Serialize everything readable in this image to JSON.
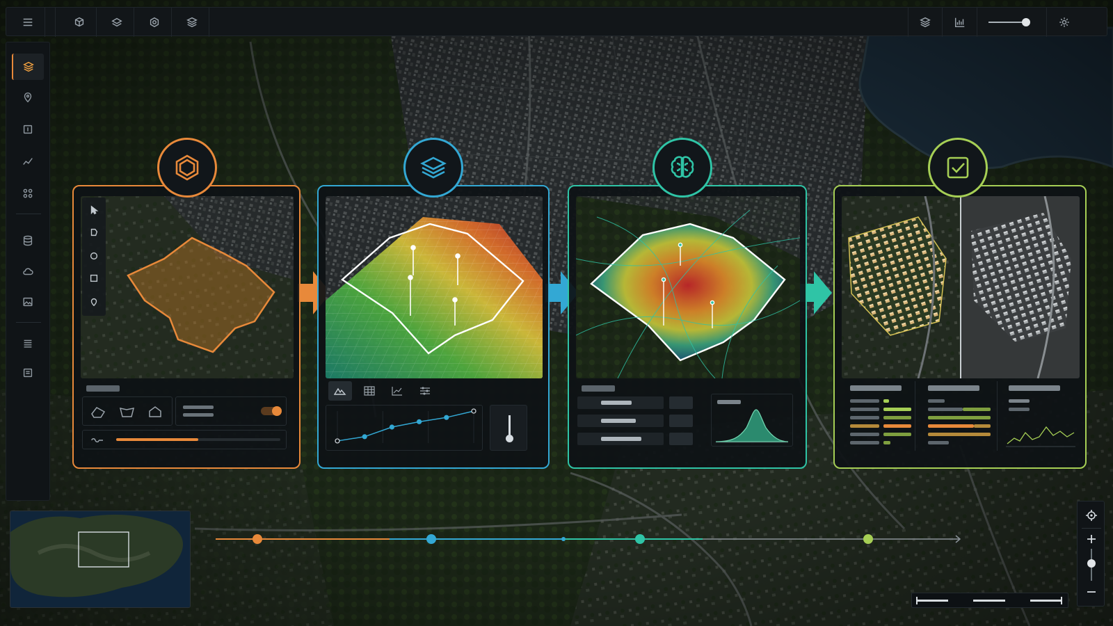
{
  "app": {
    "title": ""
  },
  "colors": {
    "stage1": "#e8893a",
    "stage2": "#33a8d4",
    "stage3": "#2fc4a6",
    "stage4": "#a6cf55",
    "panel_bg": "#0e1215",
    "toolbar_bg": "#121619"
  },
  "topbar": {
    "left_icons": [
      "menu-icon",
      "cube-icon",
      "layers-icon",
      "hexagon-icon",
      "stack-icon"
    ],
    "right_icons": [
      "layers-icon",
      "analytics-chart-icon",
      "opacity-slider",
      "gear-icon"
    ],
    "opacity_slider_value": 0.85
  },
  "sidebar": {
    "items": [
      {
        "icon": "layers-icon",
        "active": true
      },
      {
        "icon": "map-pin-icon",
        "active": false
      },
      {
        "icon": "frame-icon",
        "active": false
      },
      {
        "icon": "trend-line-icon",
        "active": false
      },
      {
        "icon": "network-icon",
        "active": false
      },
      {
        "icon": "database-icon",
        "active": false
      },
      {
        "icon": "cloud-icon",
        "active": false
      },
      {
        "icon": "image-icon",
        "active": false
      },
      {
        "icon": "list-icon",
        "active": false
      },
      {
        "icon": "report-icon",
        "active": false
      }
    ]
  },
  "stages": [
    {
      "id": "define-area",
      "icon": "hexagon-icon",
      "tools": [
        "pointer-icon",
        "polygon-icon",
        "circle-icon",
        "square-icon",
        "map-pin-icon"
      ],
      "progress": 0.5,
      "toggle_on": true
    },
    {
      "id": "layer-analysis",
      "icon": "layers-icon",
      "tabs": [
        "terrain-icon",
        "grid-icon",
        "line-chart-icon",
        "sliders-icon"
      ],
      "line_values": [
        2,
        6,
        15,
        20,
        24,
        30
      ]
    },
    {
      "id": "ai-modeling",
      "icon": "brain-icon",
      "distribution_peak": 0.75
    },
    {
      "id": "results",
      "icon": "checkbox-icon"
    }
  ],
  "timeline": {
    "markers": 4,
    "active_index": 3
  },
  "map_controls": {
    "icons": [
      "locate-icon",
      "zoom-in-icon",
      "zoom-out-icon"
    ],
    "zoom_level": 0.55
  }
}
